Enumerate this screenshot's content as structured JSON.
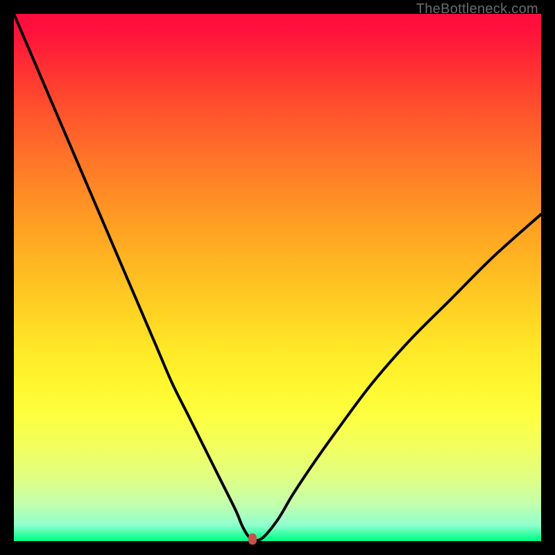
{
  "watermark": "TheBottleneck.com",
  "colors": {
    "curve": "#000000",
    "marker": "#c9504a",
    "frame": "#000000"
  },
  "chart_data": {
    "type": "line",
    "title": "",
    "xlabel": "",
    "ylabel": "",
    "xlim": [
      0,
      100
    ],
    "ylim": [
      0,
      100
    ],
    "grid": false,
    "legend": false,
    "series": [
      {
        "name": "bottleneck-curve",
        "x": [
          0,
          3,
          6,
          9,
          12,
          15,
          18,
          21,
          24,
          27,
          30,
          33,
          36,
          39,
          42,
          43.5,
          45,
          47,
          50,
          53,
          57,
          62,
          68,
          75,
          83,
          91,
          100
        ],
        "values": [
          100,
          93,
          86,
          79,
          72,
          65,
          58,
          51,
          44,
          37,
          30,
          24,
          18,
          12,
          6,
          2.5,
          0.5,
          0.5,
          4,
          9,
          15,
          22,
          30,
          38,
          46,
          54,
          62
        ]
      }
    ],
    "marker": {
      "x": 45.2,
      "y": 0.4
    },
    "background_gradient": {
      "direction": "vertical",
      "stops": [
        {
          "pos": 0,
          "color": "#ff0b3e"
        },
        {
          "pos": 50,
          "color": "#ffbf22"
        },
        {
          "pos": 76,
          "color": "#fdff3f"
        },
        {
          "pos": 97,
          "color": "#8fffce"
        },
        {
          "pos": 100,
          "color": "#00ff82"
        }
      ]
    }
  }
}
